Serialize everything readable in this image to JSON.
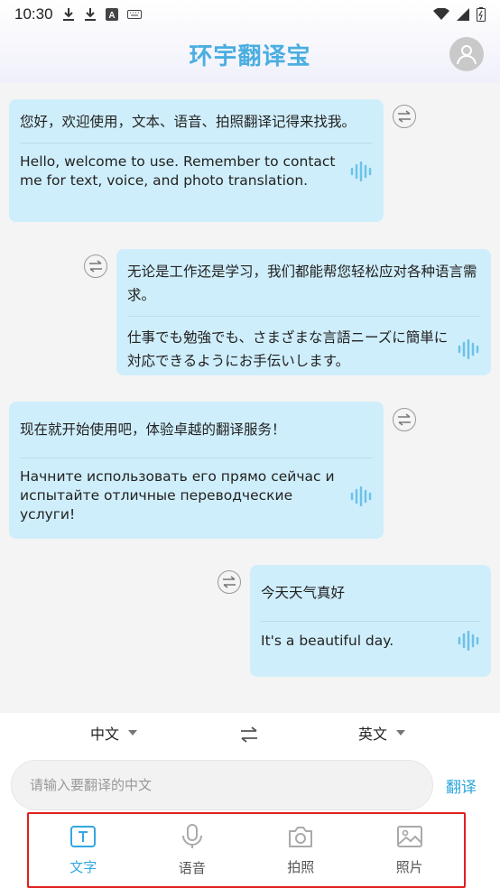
{
  "status_bar": {
    "time": "10:30",
    "icons": [
      "download-icon",
      "download-icon",
      "font-icon",
      "keyboard-icon"
    ],
    "right_icons": [
      "wifi-icon",
      "signal-icon",
      "battery-icon"
    ]
  },
  "header": {
    "title": "环宇翻译宝",
    "avatar_icon": "user-avatar-icon"
  },
  "messages": [
    {
      "side": "left",
      "source": "您好，欢迎使用，文本、语音、拍照翻译记得来找我。",
      "target": "Hello, welcome to use. Remember to contact me for text, voice, and photo translation."
    },
    {
      "side": "right",
      "source": "无论是工作还是学习，我们都能帮您轻松应对各种语言需求。",
      "target": "仕事でも勉強でも、さまざまな言語ニーズに簡単に対応できるようにお手伝いします。"
    },
    {
      "side": "left",
      "source": "现在就开始使用吧，体验卓越的翻译服务！",
      "target": "Начните использовать его прямо сейчас и испытайте отличные переводческие услуги!"
    },
    {
      "side": "right",
      "source": "今天天气真好",
      "target": "It's a beautiful day."
    }
  ],
  "language_bar": {
    "source_lang": "中文",
    "target_lang": "英文"
  },
  "input": {
    "placeholder": "请输入要翻译的中文",
    "value": ""
  },
  "translate_label": "翻译",
  "tabs": [
    {
      "label": "文字",
      "icon": "text-icon",
      "active": true
    },
    {
      "label": "语音",
      "icon": "microphone-icon",
      "active": false
    },
    {
      "label": "拍照",
      "icon": "camera-icon",
      "active": false
    },
    {
      "label": "照片",
      "icon": "image-icon",
      "active": false
    }
  ],
  "colors": {
    "accent": "#33a7e0",
    "bubble": "#cfeefb",
    "highlight_border": "#e02020"
  }
}
